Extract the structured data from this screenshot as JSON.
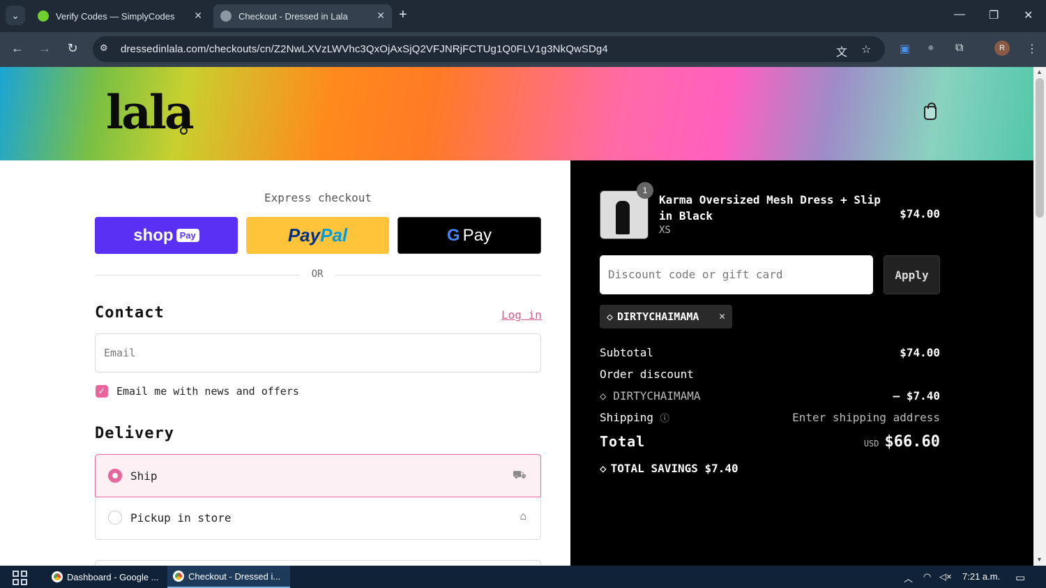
{
  "browser": {
    "tabs": [
      {
        "title": "Verify Codes — SimplyCodes",
        "active": false
      },
      {
        "title": "Checkout - Dressed in Lala",
        "active": true
      }
    ],
    "url": "dressedinlala.com/checkouts/cn/Z2NwLXVzLWVhc3QxOjAxSjQ2VFJNRjFCTUg1Q0FLV1g3NkQwSDg4",
    "profile_initial": "R"
  },
  "store": {
    "logo_text": "lala"
  },
  "express": {
    "heading": "Express checkout",
    "shop_pay": {
      "word": "shop",
      "pill": "Pay"
    },
    "paypal": {
      "part1": "Pay",
      "part2": "Pal"
    },
    "gpay": {
      "g": "G",
      "word": "Pay"
    },
    "or_label": "OR"
  },
  "contact": {
    "heading": "Contact",
    "login_label": "Log in",
    "email_placeholder": "Email",
    "newsletter_label": "Email me with news and offers",
    "newsletter_checked": true
  },
  "delivery": {
    "heading": "Delivery",
    "options": [
      {
        "label": "Ship",
        "selected": true,
        "icon": "truck-icon"
      },
      {
        "label": "Pickup in store",
        "selected": false,
        "icon": "store-icon"
      }
    ]
  },
  "summary": {
    "item": {
      "quantity": "1",
      "name": "Karma Oversized Mesh Dress + Slip in Black",
      "variant": "XS",
      "price": "$74.00"
    },
    "discount_placeholder": "Discount code or gift card",
    "apply_label": "Apply",
    "applied_code": "DIRTYCHAIMAMA",
    "subtotal_label": "Subtotal",
    "subtotal_value": "$74.00",
    "order_discount_label": "Order discount",
    "discount_code": "DIRTYCHAIMAMA",
    "discount_value": "– $7.40",
    "shipping_label": "Shipping",
    "shipping_value": "Enter shipping address",
    "total_label": "Total",
    "total_currency": "USD",
    "total_value": "$66.60",
    "savings_label": "TOTAL SAVINGS $7.40"
  },
  "taskbar": {
    "apps": [
      "Dashboard - Google ...",
      "Checkout - Dressed i..."
    ],
    "time": "7:21 a.m."
  },
  "colors": {
    "accent": "#e8669b",
    "shop_pay": "#5a31f4",
    "paypal": "#ffc439"
  }
}
